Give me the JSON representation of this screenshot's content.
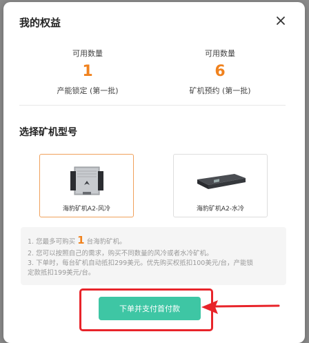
{
  "modal": {
    "title": "我的权益",
    "close_icon": "close-icon"
  },
  "stats": [
    {
      "label": "可用数量",
      "value": "1",
      "desc": "产能锁定 (第一批)"
    },
    {
      "label": "可用数量",
      "value": "6",
      "desc": "矿机预约 (第一批)"
    }
  ],
  "section": {
    "title": "选择矿机型号"
  },
  "models": [
    {
      "label": "海豹矿机A2-风冷",
      "selected": true,
      "icon": "air-cooled-miner-icon"
    },
    {
      "label": "海豹矿机A2-水冷",
      "selected": false,
      "icon": "water-cooled-miner-icon"
    }
  ],
  "notes": {
    "line1_prefix": "1. 您最多可购买",
    "line1_count": "1",
    "line1_suffix": "台海豹矿机。",
    "line2": "2. 您可以按照自己的需求，购买不同数量的风冷或者水冷矿机。",
    "line3": "3. 下单时，每台矿机自动抵扣299美元。优先购买权抵扣100美元/台，产能锁",
    "line4": "定款抵扣199美元/台。"
  },
  "cta": {
    "label": "下单并支付首付款"
  },
  "colors": {
    "accent_orange": "#f0821e",
    "cta_green": "#3ec6a4",
    "annotation_red": "#e8242a"
  }
}
